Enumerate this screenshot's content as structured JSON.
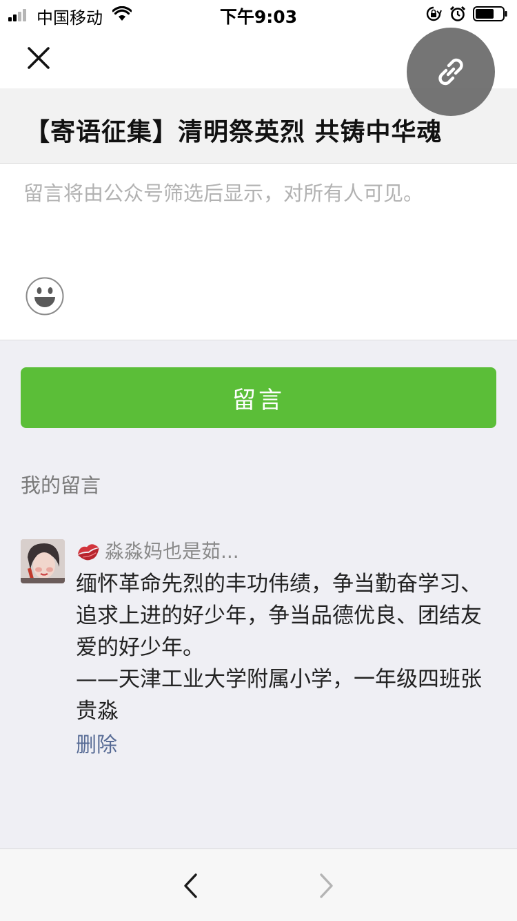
{
  "status_bar": {
    "carrier": "中国移动",
    "time": "下午9:03"
  },
  "nav": {
    "close_icon": "close-icon",
    "link_icon": "link-icon"
  },
  "article": {
    "title": "【寄语征集】清明祭英烈 共铸中华魂"
  },
  "compose": {
    "placeholder": "留言将由公众号筛选后显示，对所有人可见。",
    "value": "",
    "emoji_icon": "emoji-face-icon"
  },
  "submit": {
    "label": "留言",
    "color": "#5bbe38"
  },
  "my_comments": {
    "label": "我的留言",
    "items": [
      {
        "author": "淼淼妈也是茹...",
        "text": "缅怀革命先烈的丰功伟绩，争当勤奋学习、追求上进的好少年，争当品德优良、团结友爱的好少年。\n——天津工业大学附属小学，一年级四班张贵淼",
        "delete_label": "删除"
      }
    ]
  },
  "toolbar": {
    "back_icon": "chevron-left-icon",
    "forward_icon": "chevron-right-icon"
  },
  "colors": {
    "link_blue": "#576b95",
    "background": "#efeff4"
  }
}
